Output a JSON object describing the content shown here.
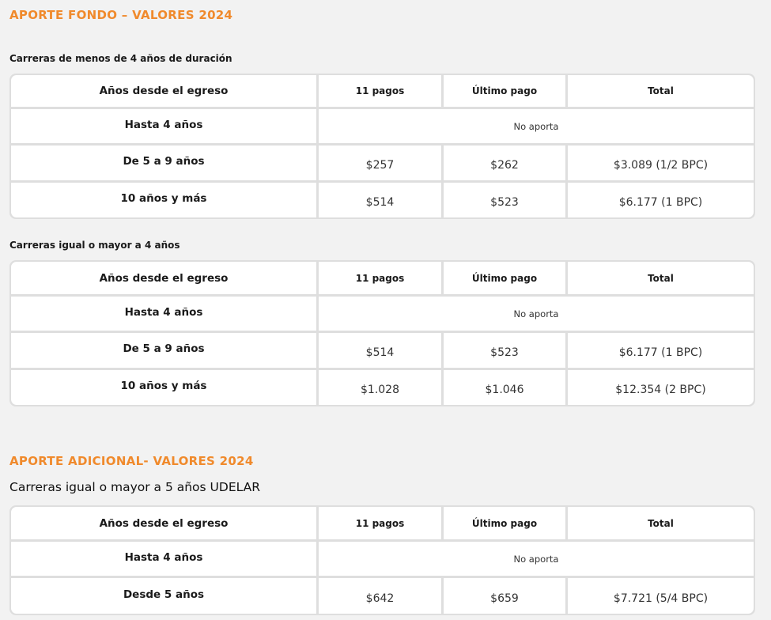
{
  "section1": {
    "title": "APORTE FONDO – VALORES 2024",
    "tables": [
      {
        "subtitle": "Carreras de menos de 4 años de duración",
        "headers": [
          "Años desde el egreso",
          "11 pagos",
          "Último pago",
          "Total"
        ],
        "rows": [
          {
            "label": "Hasta 4 años",
            "note": "No aporta"
          },
          {
            "label": "De 5 a 9 años",
            "pagos": "$257",
            "ultimo": "$262",
            "total": "$3.089 (1/2 BPC)"
          },
          {
            "label": "10 años y más",
            "pagos": "$514",
            "ultimo": "$523",
            "total": "$6.177 (1 BPC)"
          }
        ]
      },
      {
        "subtitle": "Carreras igual o mayor a 4 años",
        "headers": [
          "Años desde el egreso",
          "11 pagos",
          "Último pago",
          "Total"
        ],
        "rows": [
          {
            "label": "Hasta 4 años",
            "note": "No aporta"
          },
          {
            "label": "De 5 a 9 años",
            "pagos": "$514",
            "ultimo": "$523",
            "total": "$6.177 (1 BPC)"
          },
          {
            "label": "10 años y más",
            "pagos": "$1.028",
            "ultimo": "$1.046",
            "total": "$12.354 (2 BPC)"
          }
        ]
      }
    ]
  },
  "section2": {
    "title": "APORTE ADICIONAL- VALORES 2024",
    "tables": [
      {
        "subtitle": "Carreras igual o mayor a 5 años UDELAR",
        "headers": [
          "Años desde el egreso",
          "11 pagos",
          "Último pago",
          "Total"
        ],
        "rows": [
          {
            "label": "Hasta 4 años",
            "note": "No aporta"
          },
          {
            "label": "Desde 5 años",
            "pagos": "$642",
            "ultimo": "$659",
            "total": "$7.721 (5/4 BPC)"
          }
        ]
      }
    ]
  },
  "colors": {
    "accent": "#f08a2c",
    "background": "#f2f2f2",
    "grid": "#dedede"
  }
}
